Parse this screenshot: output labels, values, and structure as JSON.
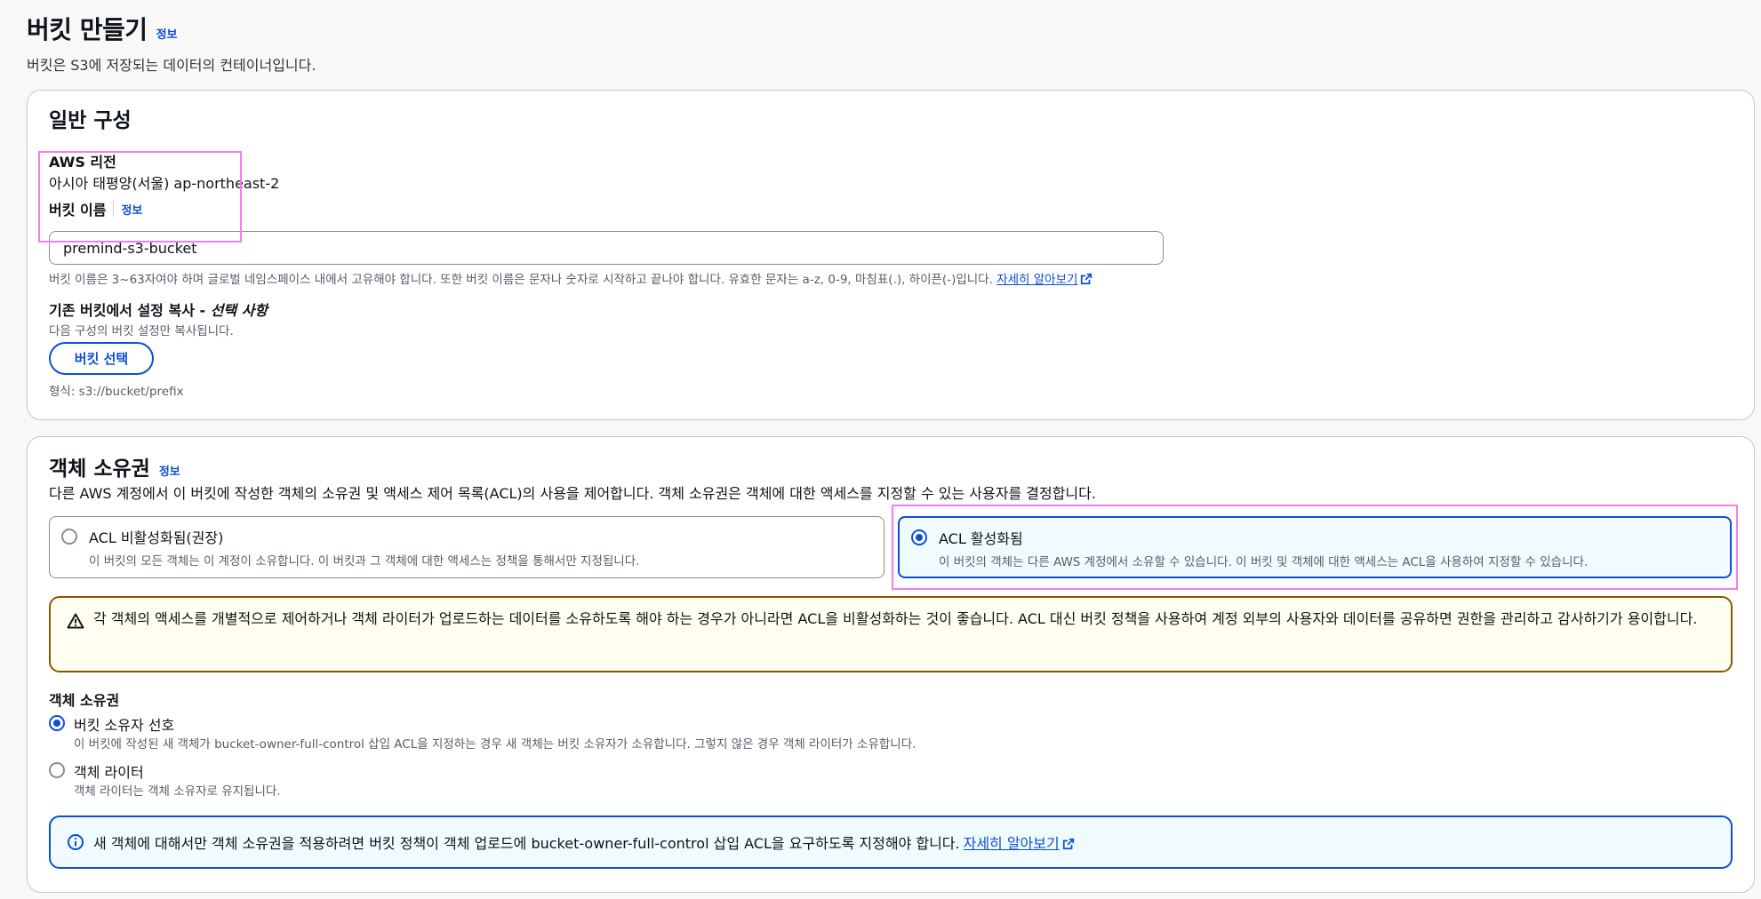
{
  "page": {
    "title": "버킷 만들기",
    "info": "정보",
    "description": "버킷은 S3에 저장되는 데이터의 컨테이너입니다."
  },
  "general": {
    "title": "일반 구성",
    "region_label": "AWS 리전",
    "region_value": "아시아 태평양(서울) ap-northeast-2",
    "bucket_name_label": "버킷 이름",
    "bucket_name_info": "정보",
    "bucket_name_value": "premind-s3-bucket",
    "bucket_name_hint": "버킷 이름은 3~63자여야 하며 글로벌 네임스페이스 내에서 고유해야 합니다. 또한 버킷 이름은 문자나 숫자로 시작하고 끝나야 합니다. 유효한 문자는 a-z, 0-9, 마침표(.), 하이픈(-)입니다.",
    "learn_more": "자세히 알아보기",
    "copy_label": "기존 버킷에서 설정 복사 - ",
    "copy_optional": "선택 사항",
    "copy_desc": "다음 구성의 버킷 설정만 복사됩니다.",
    "choose_bucket_button": "버킷 선택",
    "format_hint": "형식: s3://bucket/prefix"
  },
  "ownership": {
    "title": "객체 소유권",
    "info": "정보",
    "description": "다른 AWS 계정에서 이 버킷에 작성한 객체의 소유권 및 액세스 제어 목록(ACL)의 사용을 제어합니다. 객체 소유권은 객체에 대한 액세스를 지정할 수 있는 사용자를 결정합니다.",
    "tiles": [
      {
        "label": "ACL 비활성화됨(권장)",
        "desc": "이 버킷의 모든 객체는 이 계정이 소유합니다. 이 버킷과 그 객체에 대한 액세스는 정책을 통해서만 지정됩니다.",
        "selected": false
      },
      {
        "label": "ACL 활성화됨",
        "desc": "이 버킷의 객체는 다른 AWS 계정에서 소유할 수 있습니다. 이 버킷 및 객체에 대한 액세스는 ACL을 사용하여 지정할 수 있습니다.",
        "selected": true
      }
    ],
    "warning": "각 객체의 액세스를 개별적으로 제어하거나 객체 라이터가 업로드하는 데이터를 소유하도록 해야 하는 경우가 아니라면 ACL을 비활성화하는 것이 좋습니다. ACL 대신 버킷 정책을 사용하여 계정 외부의 사용자와 데이터를 공유하면 권한을 관리하고 감사하기가 용이합니다.",
    "owner_label": "객체 소유권",
    "options": [
      {
        "label": "버킷 소유자 선호",
        "desc": "이 버킷에 작성된 새 객체가 bucket-owner-full-control 삽입 ACL을 지정하는 경우 새 객체는 버킷 소유자가 소유합니다. 그렇지 않은 경우 객체 라이터가 소유합니다.",
        "selected": true
      },
      {
        "label": "객체 라이터",
        "desc": "객체 라이터는 객체 소유자로 유지됩니다.",
        "selected": false
      }
    ],
    "info_alert": "새 객체에 대해서만 객체 소유권을 적용하려면 버킷 정책이 객체 업로드에 bucket-owner-full-control 삽입 ACL을 요구하도록 지정해야 합니다.",
    "learn_more": "자세히 알아보기"
  },
  "colors": {
    "link": "#0a4fd6",
    "warning_border": "#855900",
    "highlight": "#f07ef0"
  }
}
